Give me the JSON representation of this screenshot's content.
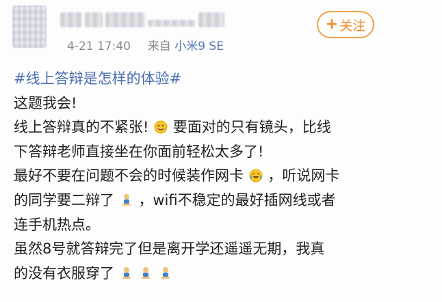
{
  "post": {
    "meta": {
      "time": "4-21 17:40",
      "source_prefix": "来自",
      "device": "小米9 SE"
    },
    "follow_label": "关注",
    "hashtag": "#线上答辩是怎样的体验#",
    "lines": [
      "这题我会!",
      "线上答辩真的不紧张!",
      "要面对的只有镜头，比线",
      "下答辩老师直接坐在你面前轻松太多了!",
      "最好不要在问题不会的时候装作网卡",
      "，听说网卡",
      "的同学要二辩了",
      "，wifi不稳定的最好插网线或者",
      "连手机热点。",
      "虽然8号就答辩完了但是离开学还遥遥无期，我真",
      "的没有衣服穿了"
    ],
    "emoji": {
      "smile": "smile-emoji",
      "laugh_cry": "laugh-cry-emoji",
      "kneel": "kneel-emoji"
    },
    "colors": {
      "hashtag": "#4a6fb6",
      "device": "#5575b8",
      "follow": "#f28a2a",
      "text": "#202020",
      "meta": "#8a8a8a"
    }
  }
}
